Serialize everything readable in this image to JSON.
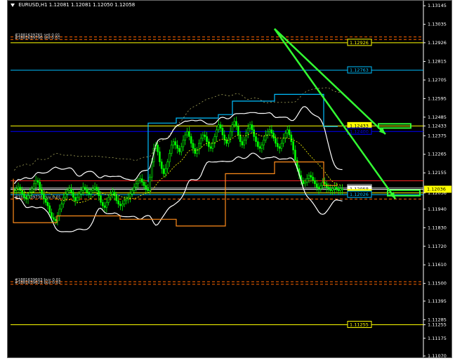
{
  "window": {
    "symbol_label": "EURUSD,H1",
    "ohlc": "1.12081 1.12081 1.12050 1.12058"
  },
  "colors": {
    "background": "#000000",
    "axis": "#ffffff",
    "candle": "#00ff00",
    "yellow_line": "#ffff00",
    "cyan_line": "#00bfff",
    "blue_line": "#0000ff",
    "orange_line": "#ff8c1a",
    "red_line": "#ff2222",
    "bands": "#ffffff",
    "green_arrow": "#33ff33"
  },
  "price_axis": {
    "min": 1.1107,
    "max": 1.1315,
    "ticks": [
      "1.13145",
      "1.13035",
      "1.12926",
      "1.12815",
      "1.12705",
      "1.12595",
      "1.12485",
      "1.12433",
      "1.12375",
      "1.12265",
      "1.12155",
      "1.12036",
      "1.11940",
      "1.11830",
      "1.11720",
      "1.11610",
      "1.11500",
      "1.11395",
      "1.11285",
      "1.11255",
      "1.11175",
      "1.11070"
    ]
  },
  "levels": [
    {
      "name": "level-1-12926",
      "price": 1.12926,
      "label": "1.12926",
      "color": "#ffff00",
      "style": "solid",
      "tag": "yellow"
    },
    {
      "name": "level-1-12763",
      "price": 1.12763,
      "label": "1.12763",
      "color": "#00bfff",
      "style": "solid",
      "tag": "cyan"
    },
    {
      "name": "level-1-12433",
      "price": 1.12433,
      "label": "1.12433",
      "color": "#ffff00",
      "style": "solid",
      "tag": "yellow-filled"
    },
    {
      "name": "level-blue",
      "price": 1.124,
      "label": "1.12400",
      "color": "#0000ff",
      "style": "solid",
      "tag": "blue"
    },
    {
      "name": "level-red",
      "price": 1.12108,
      "label": "",
      "color": "#ff2222",
      "style": "solid",
      "tag": "red"
    },
    {
      "name": "level-1-12066",
      "price": 1.12066,
      "label": "1.12066",
      "color": "#aaaaaa",
      "style": "solid",
      "tag": "gray"
    },
    {
      "name": "level-1-12058",
      "price": 1.12058,
      "label": "1.12058",
      "color": "#ffffff",
      "style": "solid",
      "tag": "white-filled"
    },
    {
      "name": "level-1-12036",
      "price": 1.12036,
      "label": "1.12036",
      "color": "#ffff00",
      "style": "solid",
      "tag": "yellow-filled"
    },
    {
      "name": "level-1-12026",
      "price": 1.12026,
      "label": "1.12026",
      "color": "#00bfff",
      "style": "solid",
      "tag": "cyan"
    },
    {
      "name": "level-1-11255",
      "price": 1.11255,
      "label": "1.11255",
      "color": "#ffff00",
      "style": "solid",
      "tag": "yellow"
    }
  ],
  "dashed_lines": [
    {
      "price": 1.1296,
      "color": "#ff6600",
      "label": "#1881639765 sell 0.01"
    },
    {
      "price": 1.12945,
      "color": "#ff6600",
      "label": "#1881639790 sell 0.01"
    },
    {
      "price": 1.12,
      "color": "#ff6600",
      "label": "#1881639738 buy 0.01"
    },
    {
      "price": 1.1151,
      "color": "#ff6600",
      "label": "#1881639603 buy 0.01"
    },
    {
      "price": 1.11495,
      "color": "#ff6600",
      "label": "#1881639623 buy 0.01"
    }
  ],
  "arrows": [
    {
      "from": [
        380,
        40
      ],
      "to": [
        538,
        190
      ]
    },
    {
      "from": [
        380,
        40
      ],
      "to": [
        552,
        282
      ]
    }
  ],
  "candles": {
    "count": 168,
    "closes": [
      1.1205,
      1.1206,
      1.1207,
      1.1205,
      1.1203,
      1.1201,
      1.12,
      1.1202,
      1.1204,
      1.1206,
      1.1209,
      1.1211,
      1.121,
      1.1206,
      1.1203,
      1.12,
      1.1198,
      1.1196,
      1.1192,
      1.1189,
      1.1188,
      1.1187,
      1.119,
      1.1194,
      1.1197,
      1.1201,
      1.1203,
      1.1205,
      1.1206,
      1.1204,
      1.1201,
      1.1199,
      1.1201,
      1.1203,
      1.1205,
      1.1207,
      1.1206,
      1.1204,
      1.1203,
      1.1205,
      1.1206,
      1.1207,
      1.1205,
      1.1202,
      1.1198,
      1.1196,
      1.1195,
      1.1198,
      1.1201,
      1.1203,
      1.1204,
      1.1202,
      1.1199,
      1.1197,
      1.1196,
      1.1197,
      1.1199,
      1.12,
      1.1201,
      1.1203,
      1.1205,
      1.1207,
      1.1209,
      1.1211,
      1.1212,
      1.121,
      1.1208,
      1.1206,
      1.1205,
      1.1213,
      1.1222,
      1.123,
      1.1232,
      1.1228,
      1.1222,
      1.1218,
      1.1215,
      1.1218,
      1.1222,
      1.1227,
      1.1232,
      1.1234,
      1.1232,
      1.123,
      1.1228,
      1.1231,
      1.1235,
      1.1238,
      1.124,
      1.1237,
      1.1233,
      1.123,
      1.1227,
      1.1229,
      1.1233,
      1.1236,
      1.1238,
      1.1237,
      1.1234,
      1.1231,
      1.123,
      1.1233,
      1.1237,
      1.1241,
      1.1244,
      1.1242,
      1.1238,
      1.1235,
      1.1233,
      1.1236,
      1.124,
      1.1244,
      1.1246,
      1.1243,
      1.1238,
      1.1234,
      1.1232,
      1.1235,
      1.1239,
      1.1242,
      1.1244,
      1.1241,
      1.1237,
      1.1234,
      1.1231,
      1.123,
      1.1232,
      1.1235,
      1.1238,
      1.124,
      1.1241,
      1.1239,
      1.1236,
      1.1233,
      1.1231,
      1.123,
      1.1233,
      1.1236,
      1.1239,
      1.1241,
      1.1238,
      1.1234,
      1.1229,
      1.1223,
      1.1218,
      1.1214,
      1.1211,
      1.1209,
      1.121,
      1.1212,
      1.1214,
      1.1213,
      1.1211,
      1.1209,
      1.1207,
      1.1206,
      1.1208,
      1.121,
      1.1209,
      1.1207,
      1.1206,
      1.1205,
      1.1206,
      1.1207,
      1.1206,
      1.1205,
      1.1206,
      1.12058
    ]
  }
}
